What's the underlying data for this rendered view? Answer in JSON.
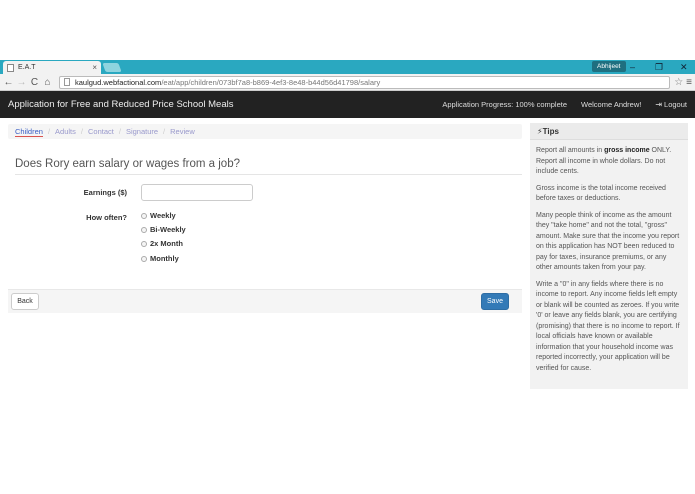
{
  "browser": {
    "tab_title": "E.A.T",
    "tab_close": "×",
    "user_badge": "Abhijeet",
    "url_host": "kaulgud.webfactional.com",
    "url_path": "/eat/app/children/073bf7a8-b869-4ef3-8e48-b44d56d41798/salary",
    "window_controls": [
      "–",
      "❐",
      "✕"
    ]
  },
  "navbar": {
    "brand": "Application for Free and Reduced Price School Meals",
    "progress": "Application Progress: 100% complete",
    "welcome": "Welcome Andrew!",
    "logout": "Logout"
  },
  "breadcrumb": {
    "items": [
      "Children",
      "Adults",
      "Contact",
      "Signature",
      "Review"
    ],
    "active_index": 0
  },
  "form": {
    "question": "Does Rory earn salary or wages from a job?",
    "earnings_label": "Earnings ($)",
    "earnings_value": "",
    "frequency_label": "How often?",
    "frequency_options": [
      "Weekly",
      "Bi-Weekly",
      "2x Month",
      "Monthly"
    ]
  },
  "buttons": {
    "back": "Back",
    "save": "Save"
  },
  "tips": {
    "title": "Tips",
    "tip1_pre": "Report all amounts in ",
    "tip1_bold": "gross income",
    "tip1_post": " ONLY. Report all income in whole dollars. Do not include cents.",
    "tip2": "Gross income is the total income received before taxes or deductions.",
    "tip3": "Many people think of income as the amount they \"take home\" and not the total, \"gross\" amount. Make sure that the income you report on this application has NOT been reduced to pay for taxes, insurance premiums, or any other amounts taken from your pay.",
    "tip4": "Write a \"0\" in any fields where there is no income to report. Any income fields left empty or blank will be counted as zeroes. If you write '0' or leave any fields blank, you are certifying (promising) that there is no income to report. If local officials have known or available information that your household income was reported incorrectly, your application will be verified for cause."
  }
}
